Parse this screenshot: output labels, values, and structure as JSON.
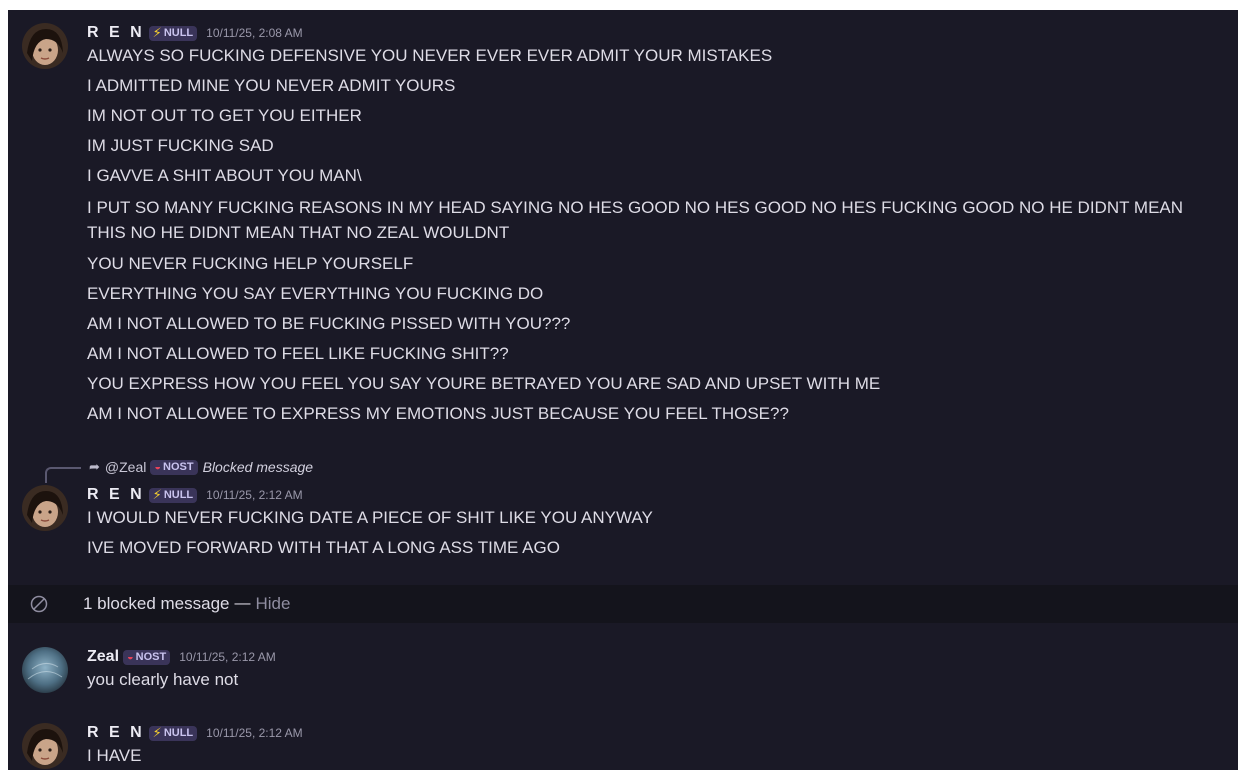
{
  "messages_block_1": {
    "user": "R E N",
    "badge": "NULL",
    "timestamp": "10/11/25, 2:08 AM",
    "lines": [
      "ALWAYS SO FUCKING DEFENSIVE YOU NEVER EVER EVER ADMIT YOUR MISTAKES",
      "I ADMITTED MINE YOU NEVER ADMIT YOURS",
      "IM NOT OUT TO GET YOU EITHER",
      "IM JUST FUCKING SAD",
      "I GAVVE A SHIT ABOUT YOU MAN\\",
      "I PUT SO MANY FUCKING REASONS IN MY HEAD SAYING NO HES GOOD NO HES GOOD NO HES FUCKING GOOD NO HE DIDNT MEAN THIS NO HE DIDNT MEAN THAT NO ZEAL WOULDNT",
      "YOU NEVER FUCKING HELP YOURSELF",
      "EVERYTHING YOU SAY EVERYTHING YOU FUCKING DO",
      "AM I NOT ALLOWED TO BE FUCKING PISSED WITH YOU???",
      "AM I NOT ALLOWED TO FEEL LIKE FUCKING SHIT??",
      "YOU EXPRESS HOW YOU FEEL YOU SAY YOURE BETRAYED YOU ARE SAD AND UPSET WITH ME",
      "AM I NOT ALLOWEE TO EXPRESS MY EMOTIONS JUST BECAUSE YOU FEEL THOSE??"
    ]
  },
  "reply_preview": {
    "mention": "@Zeal",
    "badge": "NOST",
    "text": "Blocked message"
  },
  "messages_block_2": {
    "user": "R E N",
    "badge": "NULL",
    "timestamp": "10/11/25, 2:12 AM",
    "lines": [
      "I WOULD NEVER FUCKING DATE A PIECE OF SHIT LIKE YOU ANYWAY",
      "IVE MOVED FORWARD WITH THAT A LONG ASS TIME AGO"
    ]
  },
  "blocked_notice": {
    "text": "1 blocked message",
    "separator": "—",
    "hide_label": "Hide"
  },
  "messages_block_3": {
    "user": "Zeal",
    "badge": "NOST",
    "timestamp": "10/11/25, 2:12 AM",
    "lines": [
      "you clearly have not"
    ]
  },
  "messages_block_4": {
    "user": "R E N",
    "badge": "NULL",
    "timestamp": "10/11/25, 2:12 AM",
    "lines": [
      "I HAVE"
    ]
  },
  "colors": {
    "background": "#1a1926",
    "blocked_row": "#14141c",
    "text": "#dedce6",
    "badge_bg": "#3a3459",
    "bolt": "#f5cf2e",
    "nost_ring": "#e8435a"
  }
}
